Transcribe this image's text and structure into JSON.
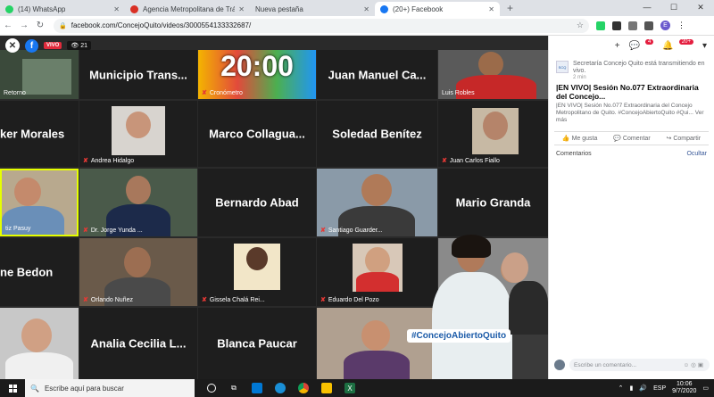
{
  "browser": {
    "tabs": [
      {
        "label": "(14) WhatsApp",
        "color": "#25d366",
        "active": false
      },
      {
        "label": "Agencia Metropolitana de Tráns",
        "color": "#d93025",
        "active": false
      },
      {
        "label": "Nueva pestaña",
        "color": "#9aa0a6",
        "active": false
      },
      {
        "label": "(20+) Facebook",
        "color": "#1877f2",
        "active": true
      }
    ],
    "new_tab": "+",
    "url": "facebook.com/ConcejoQuito/videos/3000554133332687/",
    "profile_initial": "E"
  },
  "video": {
    "live_label": "VIVO",
    "viewers": "21",
    "timer": "20:00",
    "hashtag": "#ConcejoAbiertoQuito",
    "thumb_label": "Retorno",
    "tiles": [
      {
        "big": "Municipio Trans...",
        "small": ""
      },
      {
        "big": "",
        "small": "Cronómetro"
      },
      {
        "big": "Juan Manuel Ca...",
        "small": ""
      },
      {
        "big": "",
        "small": "Luis Robles"
      },
      {
        "big": "ker Morales",
        "small": ""
      },
      {
        "big": "",
        "small": "Andrea Hidalgo"
      },
      {
        "big": "Marco Collagua...",
        "small": ""
      },
      {
        "big": "Soledad Benítez",
        "small": ""
      },
      {
        "big": "",
        "small": "Juan Carlos Fiallo"
      },
      {
        "big": "",
        "small": "tiz Pasuy"
      },
      {
        "big": "",
        "small": "Dr. Jorge Yunda ..."
      },
      {
        "big": "Bernardo Abad",
        "small": ""
      },
      {
        "big": "",
        "small": "Santiago Guarder..."
      },
      {
        "big": "Mario Granda",
        "small": ""
      },
      {
        "big": "ne Bedon",
        "small": ""
      },
      {
        "big": "",
        "small": "Orlando Nuñez"
      },
      {
        "big": "",
        "small": "Gissela Chalá Rei..."
      },
      {
        "big": "",
        "small": "Eduardo Del Pozo"
      },
      {
        "big": "Analia Cecilia L...",
        "small": ""
      },
      {
        "big": "Blanca Paucar",
        "small": ""
      }
    ]
  },
  "panel": {
    "author": "Secretaría Concejo Quito está transmitiendo en vivo.",
    "time": "2 min",
    "title": "|EN VIVO| Sesión No.077 Extraordinaria del Concejo...",
    "desc": "|EN VIVO| Sesión No.077 Extraordinaria del Concejo Metropolitano de Quito. #ConcejoAbiertoQuito #Qui... Ver más",
    "like": "Me gusta",
    "comment": "Comentar",
    "share": "Compartir",
    "comments_label": "Comentarios",
    "hide_label": "Ocultar",
    "comment_placeholder": "Escribe un comentario...",
    "badge_msgs": "4",
    "badge_notif": "20+"
  },
  "taskbar": {
    "search_placeholder": "Escribe aquí para buscar",
    "lang": "ESP",
    "time": "10:06",
    "date": "9/7/2020"
  }
}
